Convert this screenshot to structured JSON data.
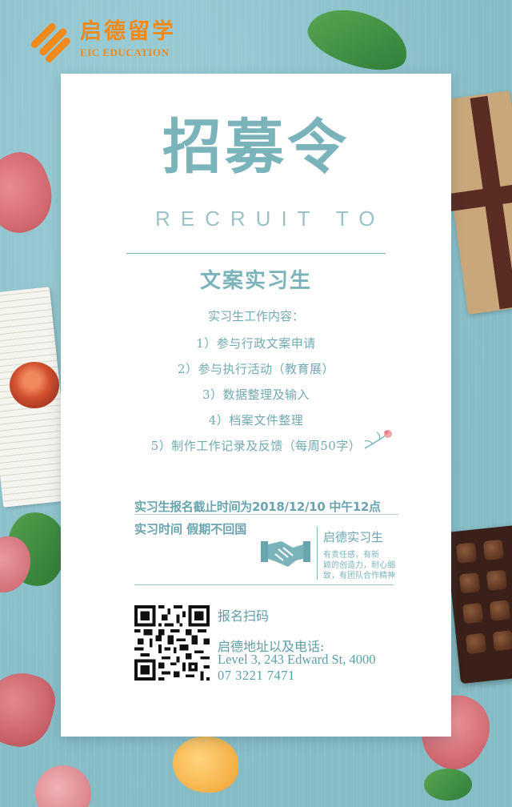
{
  "brand": {
    "name_cn": "启德留学",
    "name_en": "EIC EDUCATION",
    "color": "#f08a1c"
  },
  "poster": {
    "headline": "招募令",
    "subtitle": "RECRUIT TO",
    "position": "文案实习生",
    "duties_heading": "实习生工作内容：",
    "duties": [
      "1）参与行政文案申请",
      "2）参与执行活动（教育展）",
      "3）数据整理及输入",
      "4）档案文件整理",
      "5）制作工作记录及反馈（每周50字）"
    ],
    "deadline": "实习生报名截止时间为2018/12/10 中午12点",
    "period": "实习时间 假期不回国",
    "badge": {
      "title": "启德实习生",
      "lines": [
        "有责任感，有新",
        "颖的创造力，耐心细",
        "致，有团队合作精神"
      ]
    },
    "contact": {
      "scan_label": "报名扫码",
      "address_label": "启德地址以及电话:",
      "address": "Level 3, 243 Edward St, 4000",
      "phone": "07 3221 7471"
    },
    "accent_color": "#7bb3bb"
  }
}
